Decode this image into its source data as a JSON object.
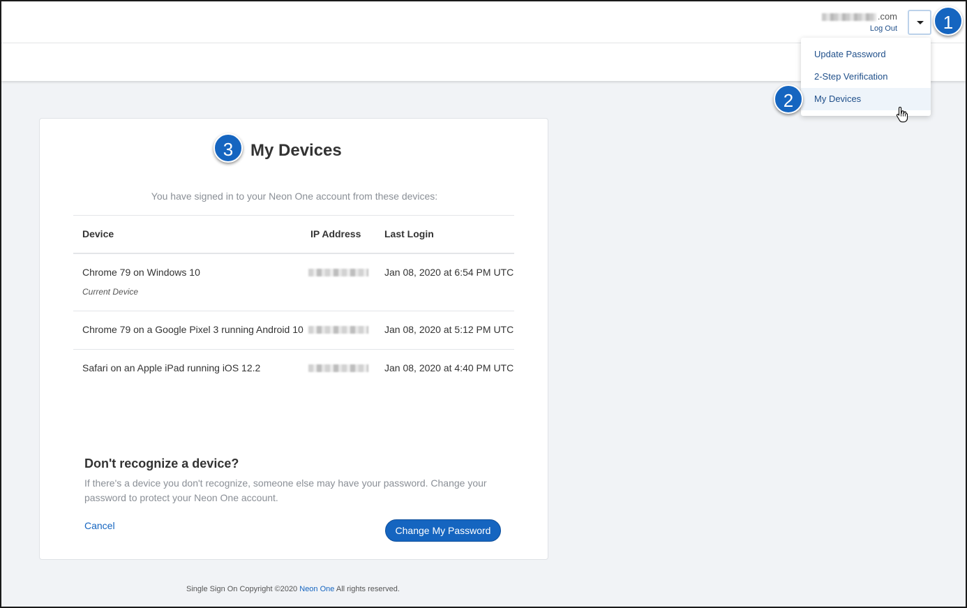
{
  "header": {
    "email_domain": ".com",
    "logout_label": "Log Out",
    "dropdown_toggle": "caret-down-icon"
  },
  "menu": {
    "items": [
      {
        "label": "Update Password"
      },
      {
        "label": "2-Step Verification"
      },
      {
        "label": "My Devices"
      }
    ]
  },
  "badges": {
    "one": "1",
    "two": "2",
    "three": "3"
  },
  "card": {
    "title": "My Devices",
    "intro": "You have signed in to your Neon One account from these devices:",
    "columns": {
      "device": "Device",
      "ip": "IP Address",
      "last_login": "Last Login"
    },
    "rows": [
      {
        "device": "Chrome 79 on Windows 10",
        "sub": "Current Device",
        "last_login": "Jan 08, 2020 at 6:54 PM UTC"
      },
      {
        "device": "Chrome 79 on a Google Pixel 3 running Android 10",
        "sub": "",
        "last_login": "Jan 08, 2020 at 5:12 PM UTC"
      },
      {
        "device": "Safari on an Apple iPad running iOS 12.2",
        "sub": "",
        "last_login": "Jan 08, 2020 at 4:40 PM UTC"
      }
    ],
    "recognize_title": "Don't recognize a device?",
    "recognize_text": "If there's a device you don't recognize, someone else may have your password. Change your password to protect your Neon One account.",
    "cancel_label": "Cancel",
    "change_password_label": "Change My Password"
  },
  "footer": {
    "prefix": "Single Sign On Copyright ©2020",
    "link": "Neon One",
    "suffix": "All rights reserved."
  },
  "colors": {
    "accent": "#1565c0",
    "link": "#1f4f8a",
    "background": "#f1f3f6"
  }
}
